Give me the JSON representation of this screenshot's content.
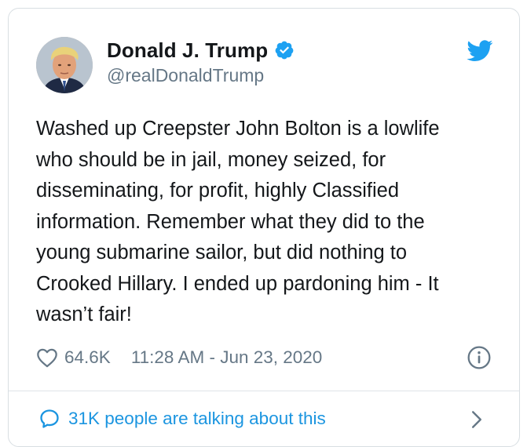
{
  "author": {
    "name": "Donald J. Trump",
    "handle": "@realDonaldTrump",
    "verified": true
  },
  "tweet": {
    "text": "Washed up Creepster John Bolton is a lowlife\nwho should be in jail, money seized, for\ndisseminating, for profit, highly Classified\ninformation. Remember what they did to the\nyoung submarine sailor, but did nothing to\nCrooked Hillary. I ended up pardoning him - It\nwasn’t fair!",
    "likes": "64.6K",
    "timestamp": "11:28 AM - Jun 23, 2020"
  },
  "footer": {
    "talking_label": "31K people are talking about this"
  },
  "icons": {
    "brand": "twitter-bird-icon",
    "verified": "verified-badge-icon",
    "like": "heart-icon",
    "info": "info-icon",
    "conversation": "speech-bubble-icon",
    "more": "chevron-right-icon"
  },
  "colors": {
    "brand_blue": "#1da1f2",
    "link_blue": "#1b95e0",
    "text_primary": "#14171a",
    "text_secondary": "#657786",
    "border": "#d8dee2"
  }
}
